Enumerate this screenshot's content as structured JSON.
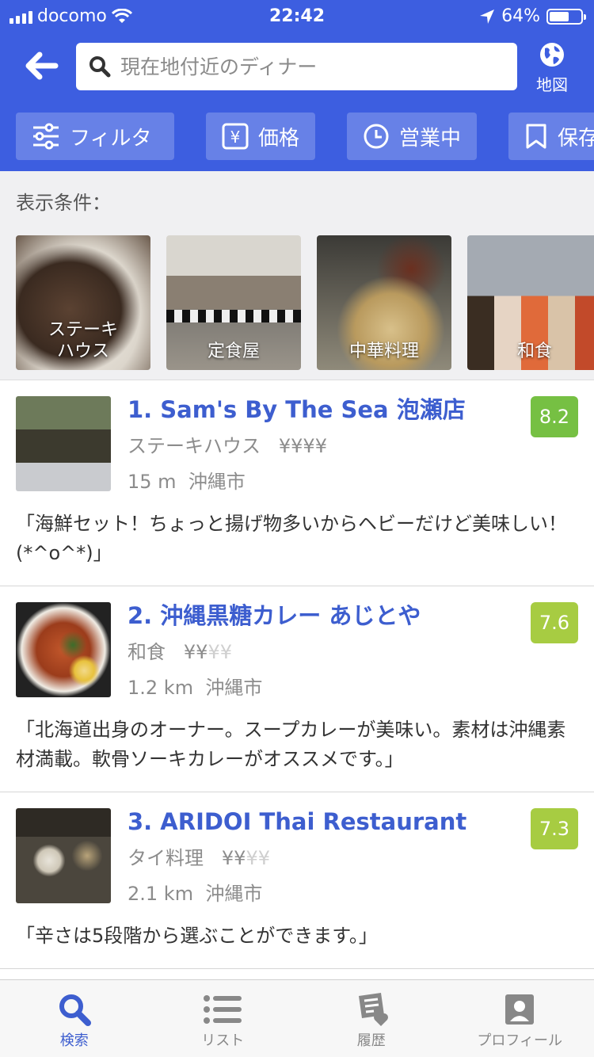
{
  "status_bar": {
    "carrier": "docomo",
    "time": "22:42",
    "battery": "64%",
    "battery_level": 0.64
  },
  "header": {
    "search_placeholder": "現在地付近のディナー",
    "map_label": "地図"
  },
  "filters": [
    {
      "label": "フィルタ",
      "icon": "sliders-icon"
    },
    {
      "label": "価格",
      "icon": "yen-icon"
    },
    {
      "label": "営業中",
      "icon": "clock-icon"
    },
    {
      "label": "保存済み",
      "icon": "bookmark-icon"
    }
  ],
  "conditions": {
    "label": "表示条件：",
    "categories": [
      {
        "label": "ステーキ\nハウス"
      },
      {
        "label": "定食屋"
      },
      {
        "label": "中華料理"
      },
      {
        "label": "和食"
      }
    ]
  },
  "results": [
    {
      "name": "1. Sam's By The Sea 泡瀬店",
      "category": "ステーキハウス",
      "price_on": "¥¥¥¥",
      "price_off": "",
      "distance": "15 m",
      "city": "沖縄市",
      "score": "8.2",
      "score_color": "#76c043",
      "quote": "「海鮮セット！ちょっと揚げ物多いからヘビーだけど美味しい！(*^o^*)」"
    },
    {
      "name": "2. 沖縄黒糖カレー あじとや",
      "category": "和食",
      "price_on": "¥¥",
      "price_off": "¥¥",
      "distance": "1.2 km",
      "city": "沖縄市",
      "score": "7.6",
      "score_color": "#a7cc42",
      "quote": "「北海道出身のオーナー。スープカレーが美味い。素材は沖縄素材満載。軟骨ソーキカレーがオススメです。」"
    },
    {
      "name": "3. ARIDOI Thai Restaurant",
      "category": "タイ料理",
      "price_on": "¥¥",
      "price_off": "¥¥",
      "distance": "2.1 km",
      "city": "沖縄市",
      "score": "7.3",
      "score_color": "#a7cc42",
      "quote": "「辛さは5段階から選ぶことができます。」"
    }
  ],
  "tabbar": [
    {
      "label": "検索",
      "icon": "search-icon",
      "active": true
    },
    {
      "label": "リスト",
      "icon": "list-icon",
      "active": false
    },
    {
      "label": "履歴",
      "icon": "history-icon",
      "active": false
    },
    {
      "label": "プロフィール",
      "icon": "profile-icon",
      "active": false
    }
  ],
  "colors": {
    "brand": "#3d5ee0",
    "link": "#3d5ecf"
  }
}
